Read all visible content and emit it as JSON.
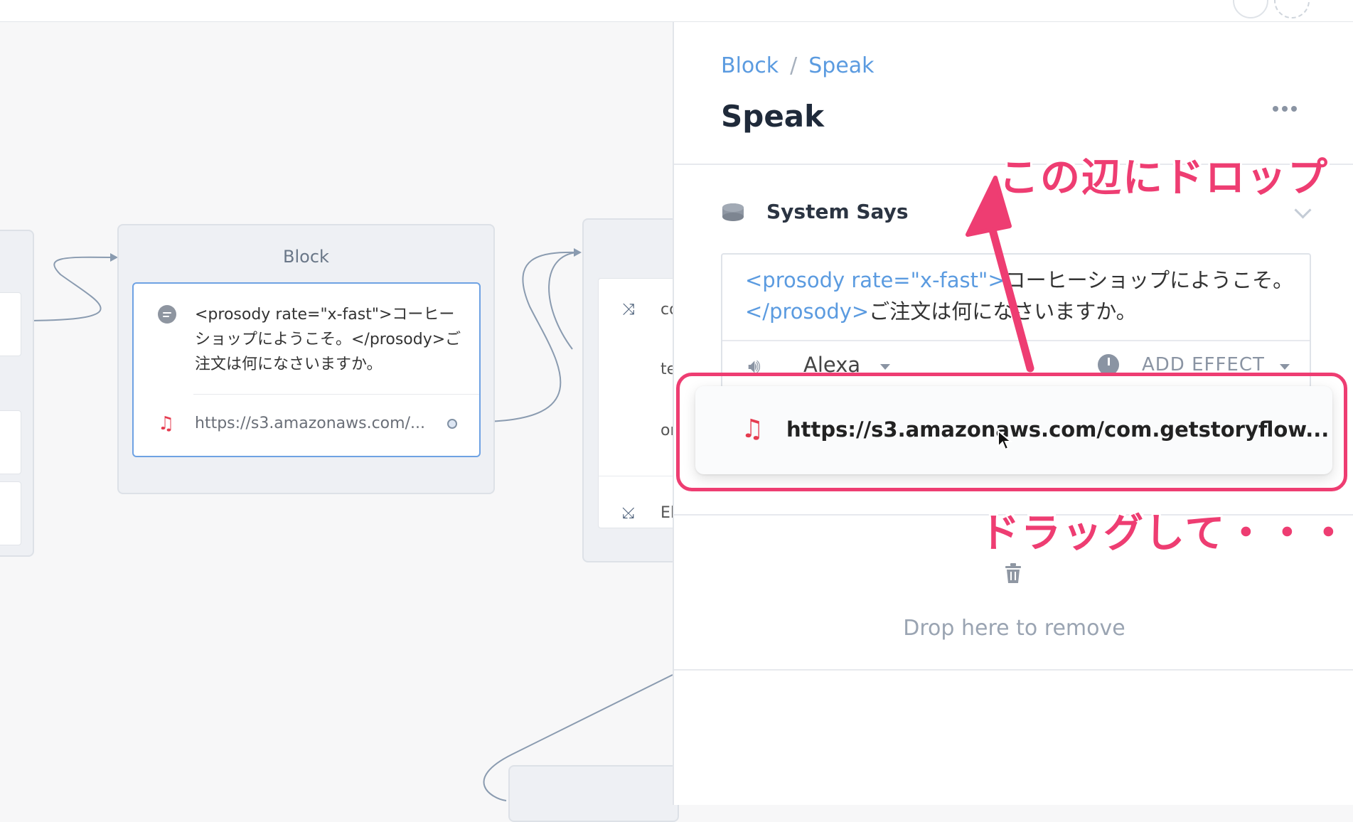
{
  "canvas": {
    "block_node": {
      "title": "Block",
      "speak_text": "<prosody rate=\"x-fast\">コーヒーショップにようこそ。</prosody>ご注文は何になさいますか。",
      "audio_url": "https://s3.amazonaws.com/..."
    },
    "right_node": {
      "items": [
        "co",
        "te",
        "or",
        "El"
      ]
    }
  },
  "sidebar": {
    "breadcrumb": [
      "Block",
      "Speak"
    ],
    "breadcrumb_sep": "/",
    "title": "Speak",
    "section": {
      "title": "System Says",
      "text_tag_open": "<prosody rate=\"x-fast\">",
      "text_line1": "コーヒーショップにようこそ。",
      "text_tag_close": "</prosody>",
      "text_line2": "ご注文は何になさいますか。",
      "voice": "Alexa",
      "effect": "ADD EFFECT"
    },
    "dragging_item": {
      "url": "https://s3.amazonaws.com/com.getstoryflow..."
    },
    "drop_label": "Drop here to remove"
  },
  "annotations": {
    "drop_here": "この辺にドロップ",
    "drag": "ドラッグして・・・"
  },
  "colors": {
    "accent_link": "#5b9be0",
    "annotation": "#ee3d72",
    "music_icon": "#e53b4f",
    "active_border": "#6ea2e3"
  },
  "icons": [
    "speech-bubble-icon",
    "music-note-icon",
    "shuffle-icon",
    "speaker-device-icon",
    "volume-icon",
    "clock-icon",
    "trash-icon",
    "more-icon",
    "chevron-down-icon",
    "mouse-cursor-icon"
  ]
}
